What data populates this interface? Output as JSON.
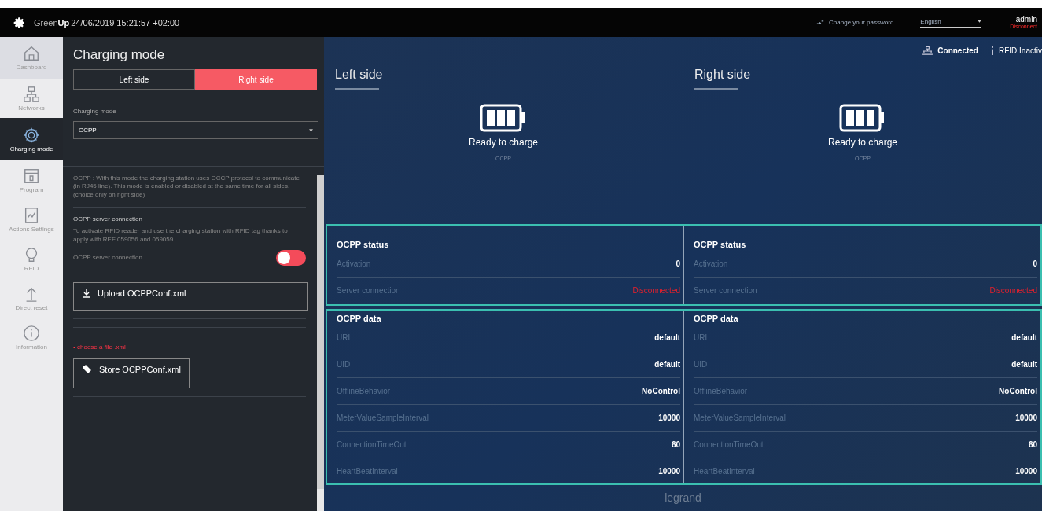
{
  "header": {
    "brand_prefix": "Green",
    "brand_bold": "Up",
    "datetime": "24/06/2019 15:21:57 +02:00",
    "change_password": "Change your password",
    "language": "English",
    "user": "admin",
    "disconnect": "Disconnect"
  },
  "sidebar": {
    "items": [
      {
        "label": "Dashboard",
        "selected": false
      },
      {
        "label": "Networks",
        "selected": false
      },
      {
        "label": "Charging mode",
        "selected": true
      },
      {
        "label": "Program",
        "selected": false
      },
      {
        "label": "Actions Settings",
        "selected": false
      },
      {
        "label": "RFID",
        "selected": false
      },
      {
        "label": "Direct reset",
        "selected": false
      },
      {
        "label": "Information",
        "selected": false
      }
    ]
  },
  "panel": {
    "title": "Charging mode",
    "sides": [
      {
        "label": "Left side",
        "selected": false
      },
      {
        "label": "Right side",
        "selected": true
      }
    ],
    "mode_label": "Charging mode",
    "mode_value": "OCPP",
    "description": "OCPP : With this mode the charging station uses OCCP protocol to communicate (in RJ45 line). This mode is enabled or disabled at the same time for all sides. (choice only on right side)",
    "server_heading": "OCPP server connection",
    "server_text": "To activate RFID reader and use the charging station with RFID tag thanks to apply with REF 059056 and 059059",
    "toggle_label": "OCPP server connection",
    "toggle_on": false,
    "upload_button": "Upload OCPPConf.xml",
    "file_hint": "• choose a file .xml",
    "store_button": "Store OCPPConf.xml"
  },
  "status_bar": {
    "network": "Connected",
    "rfid": "RFID Inactiv"
  },
  "sides": [
    {
      "title": "Left side",
      "state": "Ready to charge",
      "mode": "OCPP",
      "status_title": "OCPP status",
      "status_rows": [
        {
          "label": "Activation",
          "value": "0",
          "alert": false
        },
        {
          "label": "Server connection",
          "value": "Disconnected",
          "alert": true
        }
      ],
      "data_title": "OCPP data",
      "data_rows": [
        {
          "label": "URL",
          "value": "default"
        },
        {
          "label": "UID",
          "value": "default"
        },
        {
          "label": "OfflineBehavior",
          "value": "NoControl"
        },
        {
          "label": "MeterValueSampleInterval",
          "value": "10000"
        },
        {
          "label": "ConnectionTimeOut",
          "value": "60"
        },
        {
          "label": "HeartBeatInterval",
          "value": "10000"
        }
      ]
    },
    {
      "title": "Right side",
      "state": "Ready to charge",
      "mode": "OCPP",
      "status_title": "OCPP status",
      "status_rows": [
        {
          "label": "Activation",
          "value": "0",
          "alert": false
        },
        {
          "label": "Server connection",
          "value": "Disconnected",
          "alert": true
        }
      ],
      "data_title": "OCPP data",
      "data_rows": [
        {
          "label": "URL",
          "value": "default"
        },
        {
          "label": "UID",
          "value": "default"
        },
        {
          "label": "OfflineBehavior",
          "value": "NoControl"
        },
        {
          "label": "MeterValueSampleInterval",
          "value": "10000"
        },
        {
          "label": "ConnectionTimeOut",
          "value": "60"
        },
        {
          "label": "HeartBeatInterval",
          "value": "10000"
        }
      ]
    }
  ],
  "footer": {
    "logo": "legrand"
  }
}
